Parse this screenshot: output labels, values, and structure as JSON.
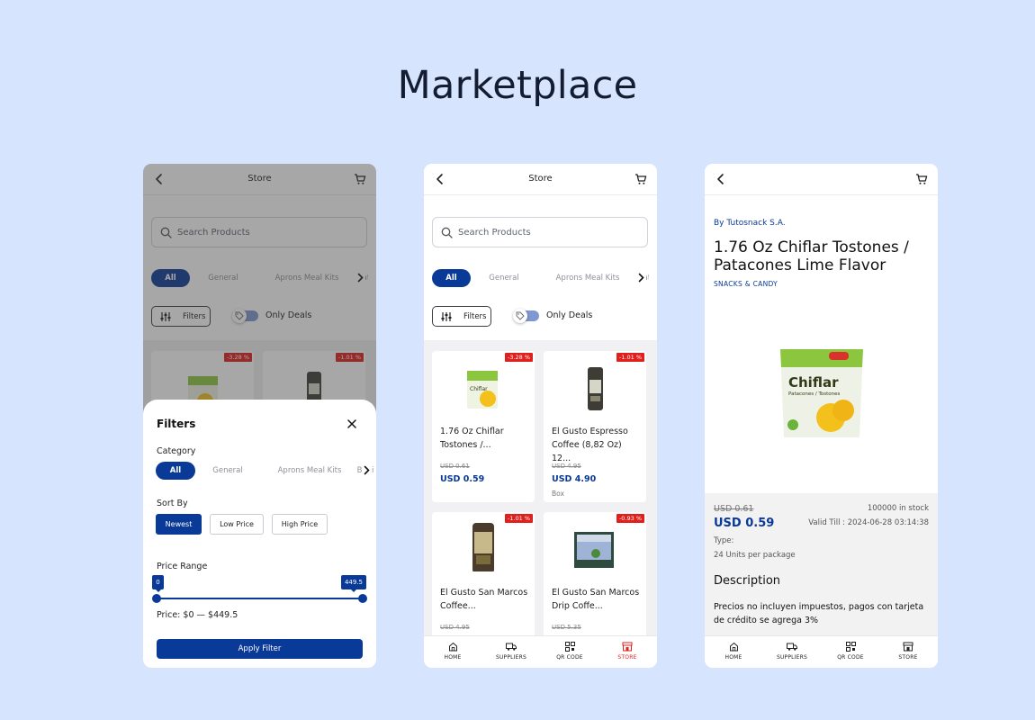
{
  "page": {
    "title": "Marketplace"
  },
  "colors": {
    "background": "#d6e4fd",
    "primary": "#0a3a97",
    "discount": "#e0201d"
  },
  "store": {
    "title": "Store",
    "search_placeholder": "Search Products",
    "categories": [
      "All",
      "General",
      "Aprons Meal Kits",
      "Bat"
    ],
    "filters_label": "Filters",
    "only_deals_label": "Only Deals",
    "products": [
      {
        "name": "1.76 Oz Chiflar Tostones /...",
        "discount": "-3.28 %",
        "old_price": "USD 0.61",
        "price": "USD 0.59",
        "unit": ""
      },
      {
        "name": "El Gusto Espresso Coffee (8,82 Oz) 12...",
        "discount": "-1.01 %",
        "old_price": "USD 4.95",
        "price": "USD 4.90",
        "unit": "Box"
      },
      {
        "name": "El Gusto San Marcos Coffee...",
        "discount": "-1.01 %",
        "old_price": "USD 4.95",
        "price": "",
        "unit": ""
      },
      {
        "name": "El Gusto San Marcos Drip Coffe...",
        "discount": "-0.93 %",
        "old_price": "USD 5.35",
        "price": "",
        "unit": ""
      }
    ]
  },
  "filters_sheet": {
    "title": "Filters",
    "category_label": "Category",
    "categories": [
      "All",
      "General",
      "Aprons Meal Kits",
      "Bebi"
    ],
    "sort_label": "Sort By",
    "sort_options": [
      "Newest",
      "Low Price",
      "High Price"
    ],
    "price_range_label": "Price Range",
    "range_min": "0",
    "range_max": "449.5",
    "price_text": "Price: $0 — $449.5",
    "apply_label": "Apply Filter"
  },
  "detail": {
    "by": "By Tutosnack S.A.",
    "title": "1.76 Oz Chiflar Tostones / Patacones Lime Flavor",
    "category": "SNACKS & CANDY",
    "old_price": "USD 0.61",
    "price": "USD 0.59",
    "stock": "100000 in stock",
    "valid_till": "Valid Till : 2024-06-28 03:14:38",
    "type_label": "Type:",
    "units": "24 Units per package",
    "description_heading": "Description",
    "description": "Precios no incluyen impuestos, pagos con tarjeta de crédito se agrega 3%"
  },
  "tabbar": {
    "items": [
      {
        "label": "HOME",
        "icon": "home-icon"
      },
      {
        "label": "SUPPLIERS",
        "icon": "truck-icon"
      },
      {
        "label": "QR CODE",
        "icon": "qr-icon"
      },
      {
        "label": "STORE",
        "icon": "store-icon"
      }
    ],
    "active_label": "STORE"
  }
}
